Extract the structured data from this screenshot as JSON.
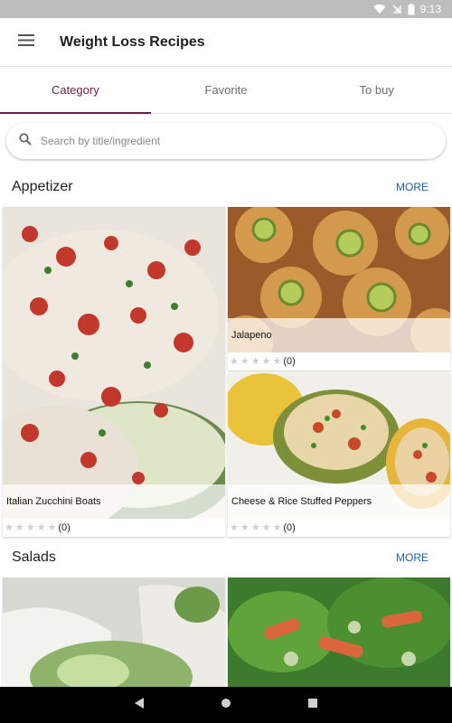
{
  "status_bar": {
    "time": "9:13"
  },
  "app_bar": {
    "title": "Weight Loss Recipes",
    "menu_icon": "hamburger-menu-icon"
  },
  "tabs": [
    {
      "label": "Category",
      "active": true
    },
    {
      "label": "Favorite",
      "active": false
    },
    {
      "label": "To buy",
      "active": false
    }
  ],
  "search": {
    "placeholder": "Search by title/ingredient",
    "value": ""
  },
  "sections": {
    "appetizer": {
      "title": "Appetizer",
      "more_label": "MORE",
      "recipes": [
        {
          "title": "Italian Zucchini Boats",
          "rating": "(0)"
        },
        {
          "title": "Jalapeno",
          "rating": "(0)"
        },
        {
          "title": "Cheese & Rice Stuffed Peppers",
          "rating": "(0)"
        }
      ]
    },
    "salads": {
      "title": "Salads",
      "more_label": "MORE"
    }
  },
  "colors": {
    "accent": "#6a1b4d",
    "link": "#1f5fa8",
    "status_bar": "#bdbdbd"
  }
}
